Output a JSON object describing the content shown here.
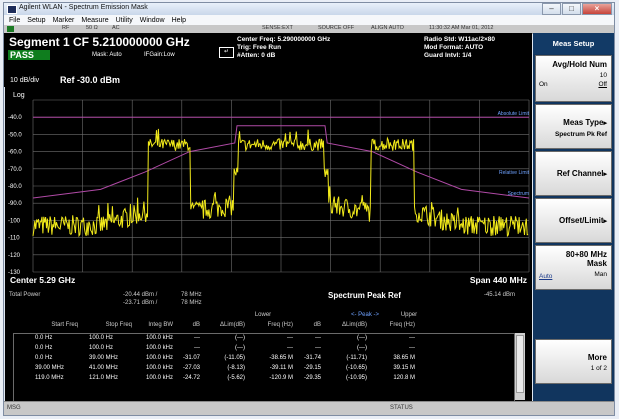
{
  "window": {
    "title": "Agilent WLAN - Spectrum Emission Mask"
  },
  "menu": [
    "File",
    "Setup",
    "Marker",
    "Measure",
    "Utility",
    "Window",
    "Help"
  ],
  "status_top": {
    "rf": "RF",
    "ohm": "50 Ω",
    "ac": "AC",
    "sense": "SENSE:EXT",
    "source": "SOURCE OFF",
    "align": "ALIGN AUTO",
    "datetime": "11:30:32 AM Mar 01, 2012"
  },
  "header": {
    "segment": "Segment 1 CF 5.210000000 GHz",
    "pass": "PASS",
    "mask": "Mask: Auto",
    "ifgain": "IFGain:Low",
    "center_freq": "Center Freq: 5.290000000 GHz",
    "trig": "Trig: Free Run",
    "atten": "#Atten: 0 dB",
    "radio_std": "Radio Std: W11ac/2×80",
    "mod_format": "Mod Format: AUTO",
    "guard": "Guard Intvl: 1/4"
  },
  "plot": {
    "scale": "10 dB/div",
    "ref": "Ref -30.0 dBm",
    "log": "Log",
    "y_ticks": [
      "-40.0",
      "-50.0",
      "-60.0",
      "-70.0",
      "-80.0",
      "-90.0",
      "-100",
      "-110",
      "-120",
      "-130"
    ],
    "abs_limit": "Absolute Limit",
    "rel_limit": "Relative Limit",
    "spectrum": "Spectrum",
    "center": "Center 5.29 GHz",
    "span": "Span 440 MHz"
  },
  "results": {
    "total_power_label": "Total Power",
    "tp1": "-20.44 dBm /",
    "tp1_bw": "78 MHz",
    "tp2": "-23.71 dBm /",
    "tp2_bw": "78 MHz",
    "title": "Spectrum Peak Ref",
    "ref_value": "-45.14 dBm",
    "lower": "Lower",
    "peak": "<- Peak ->",
    "upper": "Upper",
    "headers": [
      "Start Freq",
      "Stop Freq",
      "Integ BW",
      "dB",
      "ΔLim(dB)",
      "Freq (Hz)",
      "dB",
      "ΔLim(dB)",
      "Freq (Hz)"
    ],
    "rows": [
      [
        "0.0 Hz",
        "100.0 Hz",
        "100.0 kHz",
        "---",
        "(---)",
        "---",
        "---",
        "(---)",
        "---"
      ],
      [
        "0.0 Hz",
        "100.0 Hz",
        "100.0 kHz",
        "---",
        "(---)",
        "---",
        "---",
        "(---)",
        "---"
      ],
      [
        "0.0 Hz",
        "39.00 MHz",
        "100.0 kHz",
        "-31.07",
        "(-11.05)",
        "-38.65 M",
        "-31.74",
        "(-11.71)",
        "38.65 M"
      ],
      [
        "39.00 MHz",
        "41.00 MHz",
        "100.0 kHz",
        "-27.03",
        "(-8.13)",
        "-39.11 M",
        "-29.15",
        "(-10.65)",
        "39.15 M"
      ],
      [
        "119.0 MHz",
        "121.0 MHz",
        "100.0 kHz",
        "-24.72",
        "(-5.62)",
        "-120.9 M",
        "-29.35",
        "(-10.95)",
        "120.8 M"
      ]
    ]
  },
  "bottom": {
    "msg": "MSG",
    "status": "STATUS"
  },
  "softkeys": {
    "title": "Meas Setup",
    "avg_label": "Avg/Hold Num",
    "avg_value": "10",
    "avg_on": "On",
    "avg_off": "Off",
    "meas_type": "Meas Type",
    "meas_type_value": "Spectrum Pk Ref",
    "ref_channel": "Ref Channel",
    "offset_limit": "Offset/Limit",
    "mask_label1": "80+80 MHz",
    "mask_label2": "Mask",
    "mask_auto": "Auto",
    "mask_man": "Man",
    "more": "More",
    "more_page": "1 of 2"
  },
  "colors": {
    "trace": "#f2ea1a",
    "limit": "#b04aa6",
    "grid": "#6f6f6f",
    "background": "#000000",
    "pass": "#0f7d1e"
  }
}
